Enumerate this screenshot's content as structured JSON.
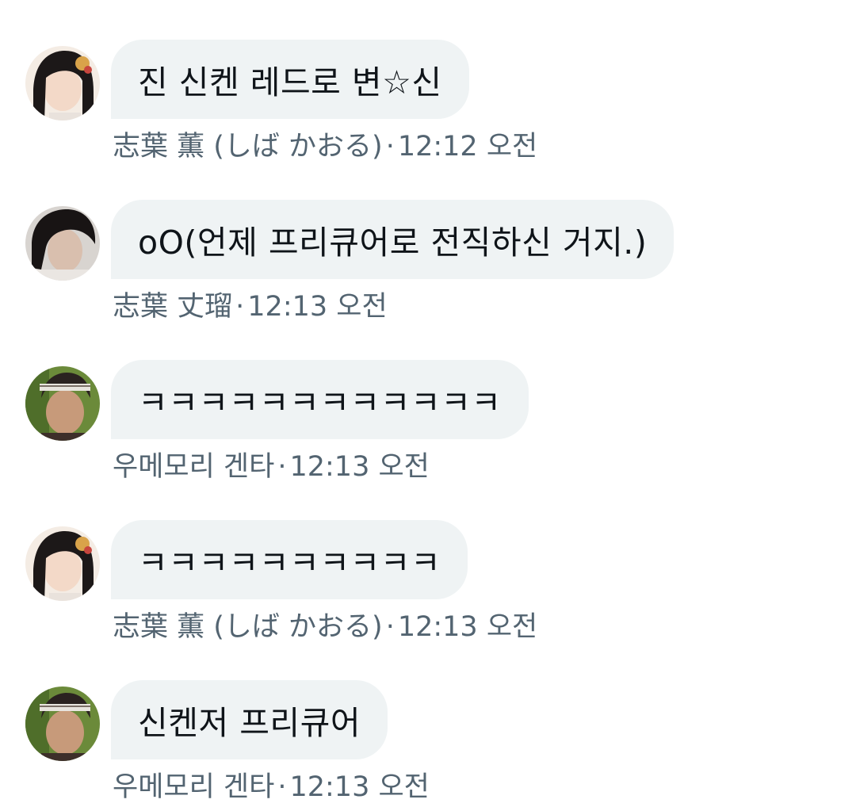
{
  "messages": [
    {
      "text": "진 신켄 레드로 변☆신",
      "sender": "志葉 薫 (しば かおる)",
      "time": "12:12 오전",
      "avatar": "kaoru-avatar"
    },
    {
      "text": "oO(언제 프리큐어로 전직하신 거지.)",
      "sender": "志葉 丈瑠",
      "time": "12:13 오전",
      "avatar": "takeru-avatar"
    },
    {
      "text": "ㅋㅋㅋㅋㅋㅋㅋㅋㅋㅋㅋㅋ",
      "sender": "우메모리 겐타",
      "time": "12:13 오전",
      "avatar": "genta-avatar"
    },
    {
      "text": "ㅋㅋㅋㅋㅋㅋㅋㅋㅋㅋ",
      "sender": "志葉 薫 (しば かおる)",
      "time": "12:13 오전",
      "avatar": "kaoru-avatar"
    },
    {
      "text": "신켄저 프리큐어",
      "sender": "우메모리 겐타",
      "time": "12:13 오전",
      "avatar": "genta-avatar"
    }
  ],
  "separator": "·",
  "colors": {
    "bubble_bg": "#eff3f4",
    "text": "#0f1419",
    "meta": "#536471"
  }
}
